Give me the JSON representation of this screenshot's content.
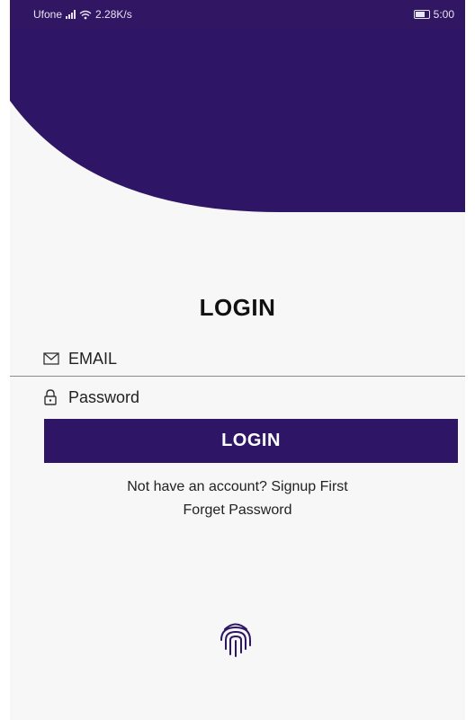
{
  "status_bar": {
    "carrier": "Ufone",
    "network_speed": "2.28K/s",
    "time": "5:00"
  },
  "colors": {
    "primary": "#2f1565",
    "background": "#f7f7f8"
  },
  "login_screen": {
    "title": "LOGIN",
    "email_placeholder": "EMAIL",
    "password_placeholder": "Password",
    "login_button": "LOGIN",
    "signup_link": "Not have an account? Signup First",
    "forget_link": "Forget Password",
    "icons": [
      "mail-icon",
      "lock-icon",
      "fingerprint-icon"
    ]
  }
}
